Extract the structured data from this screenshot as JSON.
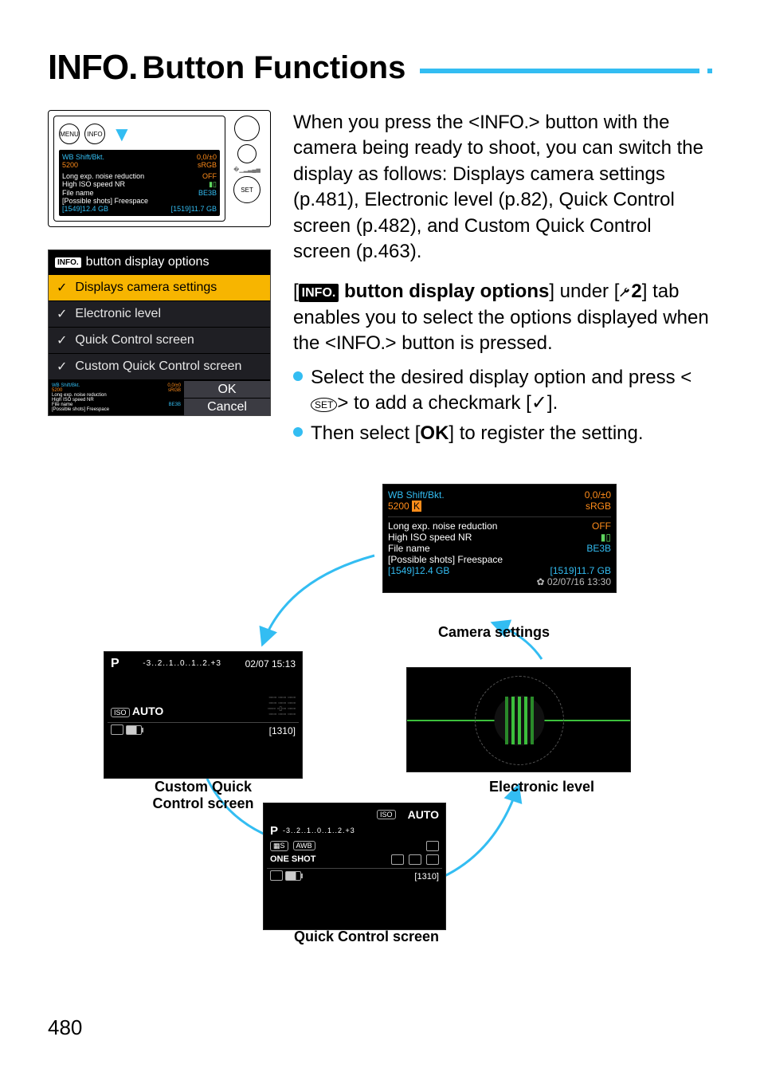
{
  "heading": {
    "info": "INFO.",
    "text": "Button Functions"
  },
  "intro": {
    "p1a": "When you press the <",
    "p1_info": "INFO.",
    "p1b": "> button with the camera being ready to shoot, you can switch the display as follows: Displays camera settings (p.481), Electronic level (p.82), Quick Control screen (p.482), and Custom Quick Control screen (p.463).",
    "p2a": "[",
    "p2_info": "INFO.",
    "p2b": " button display options",
    "p2c": "] under [",
    "p2_tab": "2",
    "p2d": "] tab enables you to select the options displayed when the <",
    "p2_info2": "INFO.",
    "p2e": "> button is pressed.",
    "b1a": "Select the desired display option and press <",
    "b1_set": "SET",
    "b1b": "> to add a checkmark [",
    "b1_chk": "✓",
    "b1c": "].",
    "b2a": "Then select [",
    "b2_ok": "OK",
    "b2b": "] to register the setting."
  },
  "cam_lcd": {
    "r1l": "WB Shift/Bkt.",
    "r1r": "0,0/±0",
    "r2l": "5200",
    "r2r": "sRGB",
    "r3l": "Long exp. noise reduction",
    "r3r": "OFF",
    "r4l": "High ISO speed NR",
    "r5l": "File name",
    "r5r": "BE3B",
    "r6": "[Possible shots] Freespace",
    "r7l": "[1549]12.4 GB",
    "r7r": "[1519]11.7 GB"
  },
  "cam_side": {
    "menu": "MENU",
    "info": "INFO",
    "set": "SET"
  },
  "menu": {
    "hdr_tag": "INFO.",
    "hdr": "button display options",
    "i1": "Displays camera settings",
    "i2": "Electronic level",
    "i3": "Quick Control screen",
    "i4": "Custom Quick Control screen",
    "ok": "OK",
    "cancel": "Cancel",
    "thumb": {
      "a": "WB Shift/Bkt.",
      "b": "0,0/±0",
      "c": "5200",
      "d": "sRGB",
      "e": "Long exp. noise reduction",
      "f": "High ISO speed NR",
      "g": "File name",
      "h": "BE3B",
      "i": "[Possible shots] Freespace"
    }
  },
  "diagram": {
    "cs": {
      "cap": "Camera settings",
      "r1l": "WB Shift/Bkt.",
      "r1r": "0,0/±0",
      "r2l": "5200",
      "r2r": "sRGB",
      "r3l": "Long exp. noise reduction",
      "r3r": "OFF",
      "r4l": "High ISO speed NR",
      "r5l": "File name",
      "r5r": "BE3B",
      "r6": "[Possible shots] Freespace",
      "r7l": "[1549]12.4 GB",
      "r7r": "[1519]11.7 GB",
      "r8": "02/07/16 13:30"
    },
    "el": {
      "cap": "Electronic level"
    },
    "cq": {
      "cap": "Custom Quick Control screen",
      "mode": "P",
      "bar": "-3..2..1..0..1..2.+3",
      "time": "02/07 15:13",
      "iso": "AUTO",
      "iso_tag": "ISO",
      "shots": "[1310]"
    },
    "qc": {
      "cap": "Quick Control screen",
      "iso_tag": "ISO",
      "iso": "AUTO",
      "mode": "P",
      "bar": "-3..2..1..0..1..2.+3",
      "awb": "AWB",
      "oneshot": "ONE SHOT",
      "shots": "[1310]"
    }
  },
  "page_number": "480"
}
